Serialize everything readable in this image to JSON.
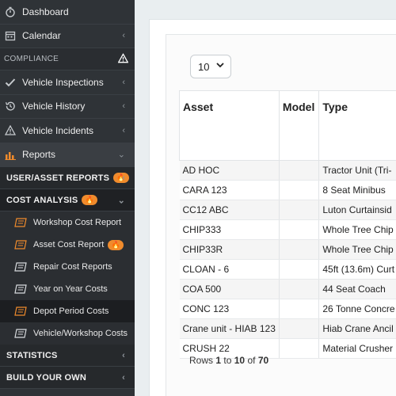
{
  "sidebar": {
    "items_top": [
      {
        "label": "Dashboard",
        "icon": "stopwatch-icon"
      },
      {
        "label": "Calendar",
        "icon": "calendar-icon"
      }
    ],
    "compliance_label": "COMPLIANCE",
    "compliance_items": [
      {
        "label": "Vehicle Inspections",
        "icon": "check-icon"
      },
      {
        "label": "Vehicle History",
        "icon": "history-icon"
      },
      {
        "label": "Vehicle Incidents",
        "icon": "warning-icon"
      }
    ],
    "reports_label": "Reports",
    "user_asset_reports": "USER/ASSET REPORTS",
    "cost_analysis": "COST ANALYSIS",
    "cost_items": [
      {
        "label": "Workshop Cost Report",
        "hot": false
      },
      {
        "label": "Asset Cost Report",
        "hot": true
      },
      {
        "label": "Repair Cost Reports",
        "hot": false
      },
      {
        "label": "Year on Year Costs",
        "hot": false
      },
      {
        "label": "Depot Period Costs",
        "hot": false
      },
      {
        "label": "Vehicle/Workshop Costs",
        "hot": false
      }
    ],
    "statistics": "STATISTICS",
    "build_your_own": "BUILD YOUR OWN",
    "flame_glyph": "🔥"
  },
  "page_size": {
    "selected": "10"
  },
  "table": {
    "headers": {
      "asset": "Asset",
      "model": "Model",
      "type": "Type"
    },
    "rows": [
      {
        "asset": "AD HOC",
        "model": "",
        "type": "Tractor Unit (Tri-"
      },
      {
        "asset": "CARA 123",
        "model": "",
        "type": "8 Seat Minibus"
      },
      {
        "asset": "CC12 ABC",
        "model": "",
        "type": "Luton Curtainsid"
      },
      {
        "asset": "CHIP333",
        "model": "",
        "type": "Whole Tree Chip"
      },
      {
        "asset": "CHIP33R",
        "model": "",
        "type": "Whole Tree Chip"
      },
      {
        "asset": "CLOAN - 6",
        "model": "",
        "type": "45ft (13.6m) Curt"
      },
      {
        "asset": "COA 500",
        "model": "",
        "type": "44 Seat Coach"
      },
      {
        "asset": "CONC 123",
        "model": "",
        "type": "26 Tonne Concre"
      },
      {
        "asset": "Crane unit - HIAB 123",
        "model": "",
        "type": "Hiab Crane Ancil"
      },
      {
        "asset": "CRUSH 22",
        "model": "",
        "type": "Material Crusher"
      }
    ]
  },
  "pagination": {
    "prefix": "Rows",
    "from": "1",
    "to_word": "to",
    "to": "10",
    "of_word": "of",
    "total": "70"
  }
}
